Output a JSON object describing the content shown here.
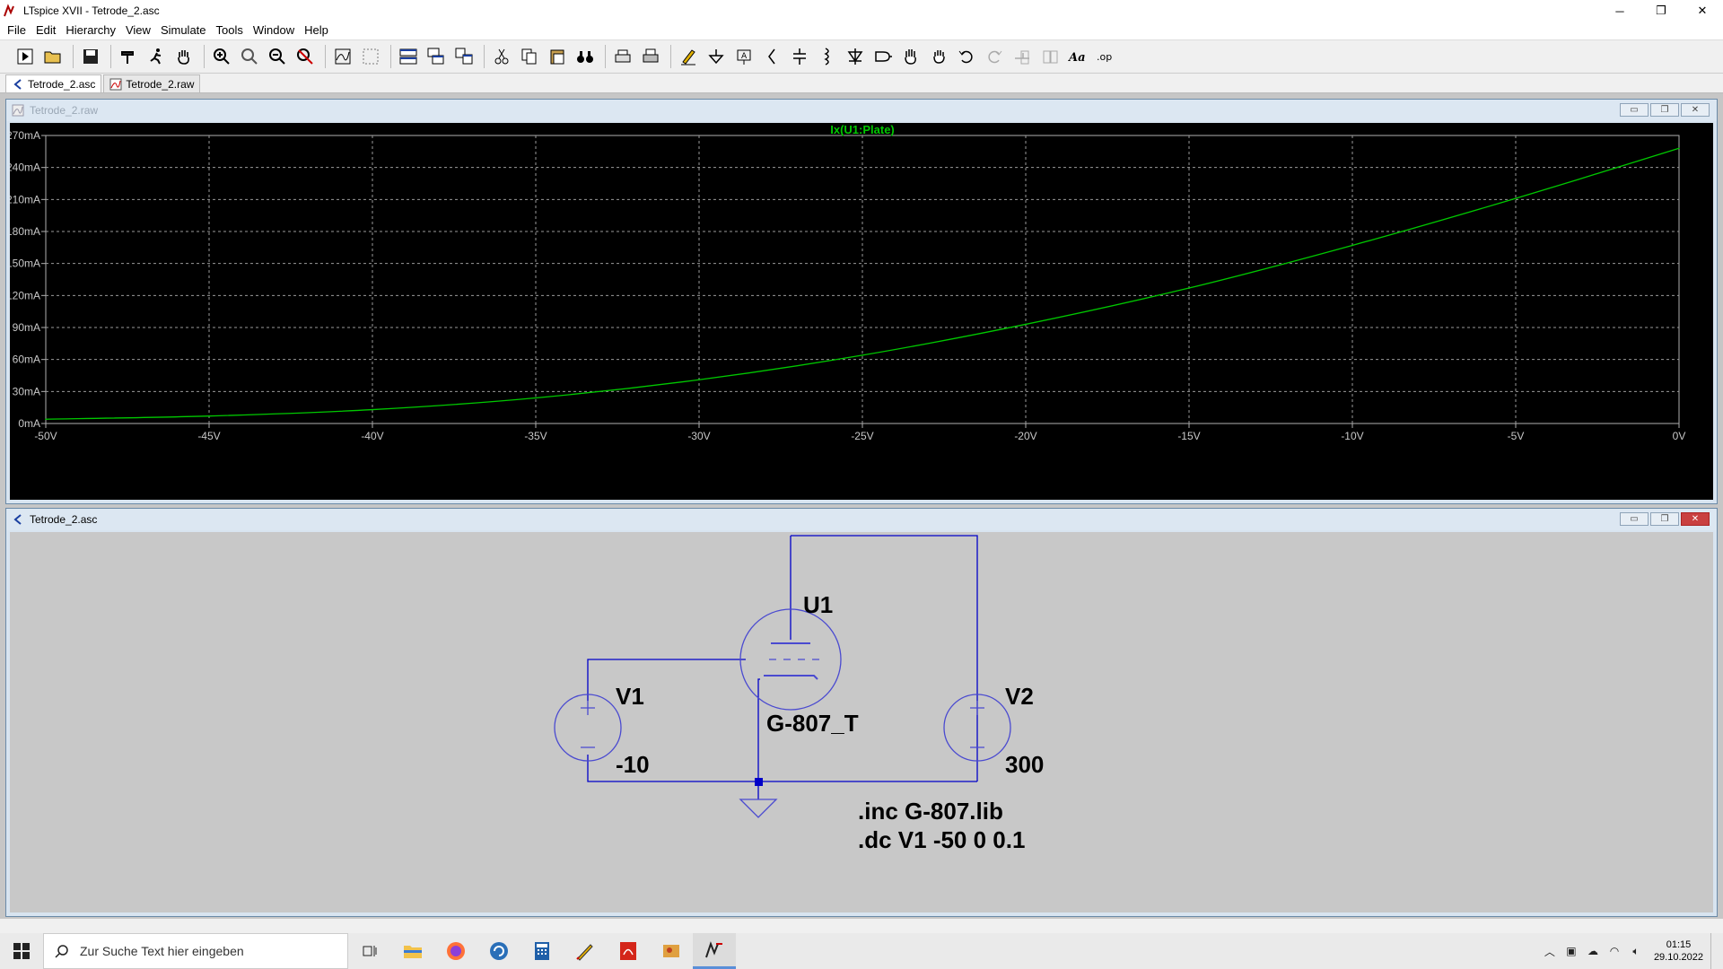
{
  "window": {
    "title": "LTspice XVII - Tetrode_2.asc"
  },
  "menu": [
    "File",
    "Edit",
    "Hierarchy",
    "View",
    "Simulate",
    "Tools",
    "Window",
    "Help"
  ],
  "tabs": [
    {
      "label": "Tetrode_2.asc",
      "icon": "schematic-icon",
      "active": true
    },
    {
      "label": "Tetrode_2.raw",
      "icon": "waveform-icon",
      "active": false
    }
  ],
  "plot_window": {
    "title": "Tetrode_2.raw"
  },
  "schematic_window": {
    "title": "Tetrode_2.asc"
  },
  "chart_data": {
    "type": "line",
    "background": "#000000",
    "grid": true,
    "legend": "top-center",
    "xlim": [
      -50,
      0
    ],
    "ylim": [
      0,
      270
    ],
    "x_ticks": [
      "-50V",
      "-45V",
      "-40V",
      "-35V",
      "-30V",
      "-25V",
      "-20V",
      "-15V",
      "-10V",
      "-5V",
      "0V"
    ],
    "y_ticks": [
      "0mA",
      "30mA",
      "60mA",
      "90mA",
      "120mA",
      "150mA",
      "180mA",
      "210mA",
      "240mA",
      "270mA"
    ],
    "series": [
      {
        "name": "Ix(U1:Plate)",
        "color": "#00c800",
        "x": [
          -50,
          -45,
          -40,
          -35,
          -30,
          -25,
          -20,
          -15,
          -10,
          -5,
          0
        ],
        "y": [
          4,
          7,
          13,
          24,
          41,
          64,
          93,
          127,
          167,
          211,
          258
        ]
      }
    ]
  },
  "schematic": {
    "tube_ref": "U1",
    "tube_model": "G-807_T",
    "v1_name": "V1",
    "v1_value": "-10",
    "v2_name": "V2",
    "v2_value": "300",
    "directive_inc": ".inc G-807.lib",
    "directive_dc": ".dc V1 -50 0 0.1",
    "wire_color": "#0000c8",
    "symbol_color": "#4a4ad0"
  },
  "taskbar": {
    "search_placeholder": "Zur Suche Text hier eingeben",
    "time": "01:15",
    "date": "29.10.2022"
  },
  "colors": {
    "accent": "#5a8fd8",
    "trace": "#00c800"
  }
}
